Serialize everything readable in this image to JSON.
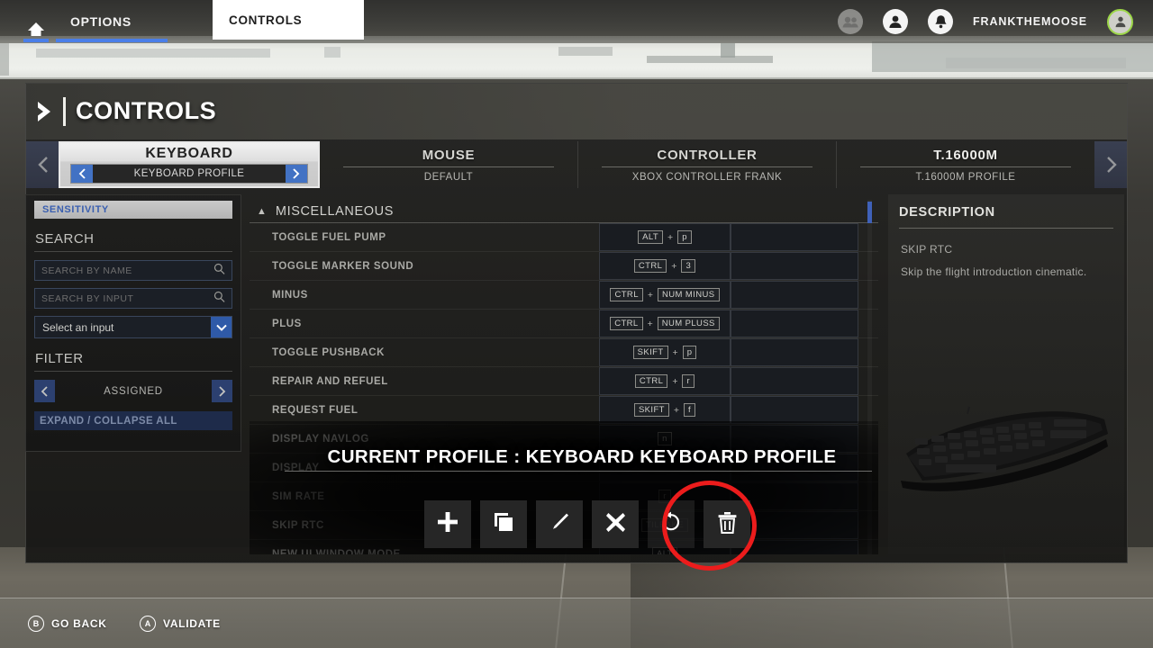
{
  "topbar": {
    "home_icon": "home-icon",
    "options_label": "OPTIONS",
    "controls_tab_label": "CONTROLS",
    "friends_icon": "friends-icon",
    "profile_icon": "profile-icon",
    "bell_icon": "bell-icon",
    "username": "FRANKTHEMOOSE",
    "avatar_icon": "avatar-icon",
    "accent_blue": "#4a7ee8",
    "avatar_ring": "#9cd648"
  },
  "panel": {
    "title": "CONTROLS",
    "chevron_icon": "chevron-right-icon"
  },
  "devices": {
    "prev_arrow_icon": "chevron-left-icon",
    "next_arrow_icon": "chevron-right-icon",
    "tabs": [
      {
        "name": "KEYBOARD",
        "profile": "KEYBOARD PROFILE",
        "active": true
      },
      {
        "name": "MOUSE",
        "profile": "DEFAULT",
        "active": false
      },
      {
        "name": "CONTROLLER",
        "profile": "XBOX CONTROLLER FRANK",
        "active": false
      },
      {
        "name": "T.16000M",
        "profile": "T.16000M PROFILE",
        "active": false
      }
    ]
  },
  "sidebar": {
    "sensitivity_label": "SENSITIVITY",
    "search_heading": "SEARCH",
    "search_by_name_placeholder": "SEARCH BY NAME",
    "search_by_input_placeholder": "SEARCH BY INPUT",
    "select_input_value": "Select an input",
    "filter_heading": "FILTER",
    "filter_value": "ASSIGNED",
    "expand_collapse_label": "EXPAND / COLLAPSE ALL",
    "search_icon": "search-icon",
    "dropdown_icon": "chevron-down-icon",
    "filter_prev_icon": "chevron-left-icon",
    "filter_next_icon": "chevron-right-icon"
  },
  "bindings": {
    "group_name": "MISCELLANEOUS",
    "group_collapse_icon": "caret-up-icon",
    "rows": [
      {
        "name": "TOGGLE FUEL PUMP",
        "keys": [
          "ALT",
          "p"
        ]
      },
      {
        "name": "TOGGLE MARKER SOUND",
        "keys": [
          "CTRL",
          "3"
        ]
      },
      {
        "name": "MINUS",
        "keys": [
          "CTRL",
          "NUM MINUS"
        ]
      },
      {
        "name": "PLUS",
        "keys": [
          "CTRL",
          "NUM PLUSS"
        ]
      },
      {
        "name": "TOGGLE PUSHBACK",
        "keys": [
          "SKIFT",
          "p"
        ]
      },
      {
        "name": "REPAIR AND REFUEL",
        "keys": [
          "CTRL",
          "r"
        ]
      },
      {
        "name": "REQUEST FUEL",
        "keys": [
          "SKIFT",
          "f"
        ]
      },
      {
        "name": "DISPLAY NAVLOG",
        "keys": [
          "n"
        ]
      },
      {
        "name": "DISPLAY",
        "keys": []
      },
      {
        "name": "SIM RATE",
        "keys": [
          "r"
        ]
      },
      {
        "name": "SKIP RTC",
        "keys": [
          "TILBAKE"
        ]
      },
      {
        "name": "NEW UI WINDOW MODE",
        "keys": [
          "ALT"
        ]
      }
    ]
  },
  "description": {
    "heading": "DESCRIPTION",
    "item_name": "SKIP RTC",
    "item_text": "Skip the flight introduction cinematic.",
    "image": "keyboard-image"
  },
  "overlay": {
    "current_profile_text": "CURRENT PROFILE : KEYBOARD KEYBOARD PROFILE",
    "buttons": [
      {
        "name": "add-profile-button",
        "icon": "plus-icon"
      },
      {
        "name": "duplicate-profile-button",
        "icon": "copy-icon"
      },
      {
        "name": "rename-profile-button",
        "icon": "pencil-icon"
      },
      {
        "name": "close-button",
        "icon": "x-icon"
      },
      {
        "name": "reset-profile-button",
        "icon": "undo-icon"
      },
      {
        "name": "delete-profile-button",
        "icon": "trash-icon"
      }
    ],
    "highlight_color": "#ec1c1c",
    "highlight_target": "delete-profile-button"
  },
  "bottombar": {
    "go_back_key": "B",
    "go_back_label": "GO BACK",
    "validate_key": "A",
    "validate_label": "VALIDATE"
  }
}
